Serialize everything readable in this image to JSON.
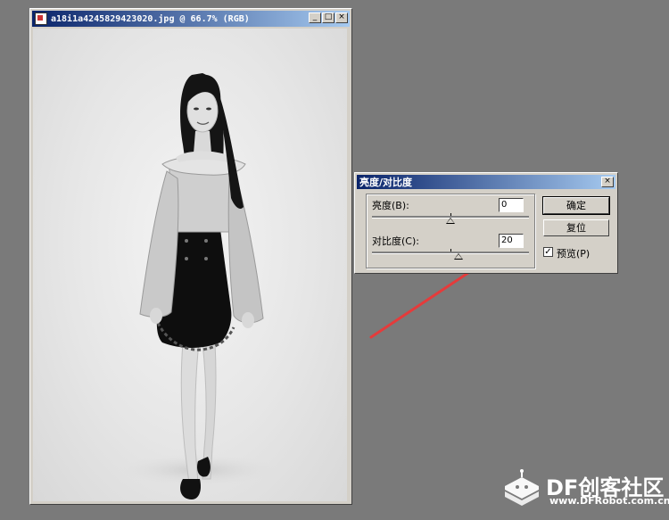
{
  "document": {
    "title": "a18i1a4245829423020.jpg @ 66.7% (RGB)",
    "controls": {
      "minimize": "_",
      "maximize": "□",
      "close": "×"
    }
  },
  "dialog": {
    "title": "亮度/对比度",
    "close": "×",
    "brightness": {
      "label": "亮度(B):",
      "value": "0",
      "slider_level_fraction": 0.5
    },
    "contrast": {
      "label": "对比度(C):",
      "value": "20",
      "slider_level_fraction": 0.55
    },
    "ok_label": "确定",
    "reset_label": "复位",
    "preview_label": "预览(P)",
    "preview_checked": true,
    "check_mark": "✓"
  },
  "annotation": {
    "arrow_color": "#e53b3b"
  },
  "watermark": {
    "brand": "DF创客社区",
    "site": "www.DFRobot.com.cn"
  },
  "colors": {
    "titlebar_start": "#0a246a",
    "titlebar_end": "#a6caf0",
    "dialog_face": "#d4d0c8",
    "desktop": "#7a7a7a"
  }
}
